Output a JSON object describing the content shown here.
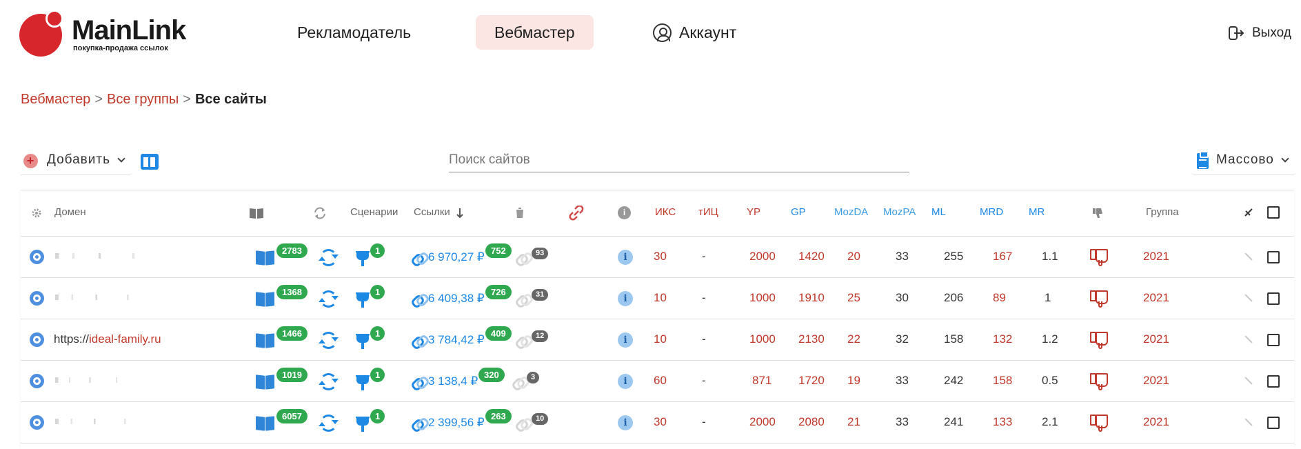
{
  "brand": {
    "name": "MainLink",
    "tagline": "покупка-продажа ссылок",
    "accent": "#d7262c"
  },
  "nav": {
    "advertiser": "Рекламодатель",
    "webmaster": "Вебмастер",
    "account": "Аккаунт",
    "logout": "Выход"
  },
  "breadcrumb": {
    "root": "Вебмастер",
    "sep": ">",
    "groups": "Все группы",
    "current": "Все сайты"
  },
  "toolbar": {
    "add_label": "Добавить",
    "search_placeholder": "Поиск сайтов",
    "mass_label": "Массово"
  },
  "table": {
    "headers": {
      "domain": "Домен",
      "scenarios": "Сценарии",
      "links": "Ссылки",
      "iks": "ИКС",
      "tic": "тИЦ",
      "yp": "YP",
      "gp": "GP",
      "mozda": "MozDA",
      "mozpa": "MozPA",
      "ml": "ML",
      "mrd": "MRD",
      "mr": "MR",
      "group": "Группа"
    },
    "rows": [
      {
        "domain": "",
        "pages": "2783",
        "scen": "1",
        "price": "6 970,27 ₽",
        "links_count": "752",
        "broken": "93",
        "iks": "30",
        "tic": "-",
        "yp": "2000",
        "gp": "1420",
        "mozda": "20",
        "mozpa": "33",
        "ml": "255",
        "mrd": "167",
        "mr": "1.1",
        "group": "2021"
      },
      {
        "domain": "",
        "pages": "1368",
        "scen": "1",
        "price": "6 409,38 ₽",
        "links_count": "726",
        "broken": "31",
        "iks": "10",
        "tic": "-",
        "yp": "1000",
        "gp": "1910",
        "mozda": "25",
        "mozpa": "30",
        "ml": "206",
        "mrd": "89",
        "mr": "1",
        "group": "2021"
      },
      {
        "domain_prefix": "https://",
        "domain": "ideal-family.ru",
        "pages": "1466",
        "scen": "1",
        "price": "3 784,42 ₽",
        "links_count": "409",
        "broken": "12",
        "iks": "10",
        "tic": "-",
        "yp": "1000",
        "gp": "2130",
        "mozda": "22",
        "mozpa": "32",
        "ml": "158",
        "mrd": "132",
        "mr": "1.2",
        "group": "2021"
      },
      {
        "domain": "",
        "pages": "1019",
        "scen": "1",
        "price": "3 138,4 ₽",
        "links_count": "320",
        "broken": "3",
        "iks": "60",
        "tic": "-",
        "yp": "871",
        "gp": "1720",
        "mozda": "19",
        "mozpa": "33",
        "ml": "242",
        "mrd": "158",
        "mr": "0.5",
        "group": "2021"
      },
      {
        "domain": "",
        "pages": "6057",
        "scen": "1",
        "price": "2 399,56 ₽",
        "links_count": "263",
        "broken": "10",
        "iks": "30",
        "tic": "-",
        "yp": "2000",
        "gp": "2080",
        "mozda": "21",
        "mozpa": "33",
        "ml": "241",
        "mrd": "133",
        "mr": "2.1",
        "group": "2021"
      }
    ]
  }
}
